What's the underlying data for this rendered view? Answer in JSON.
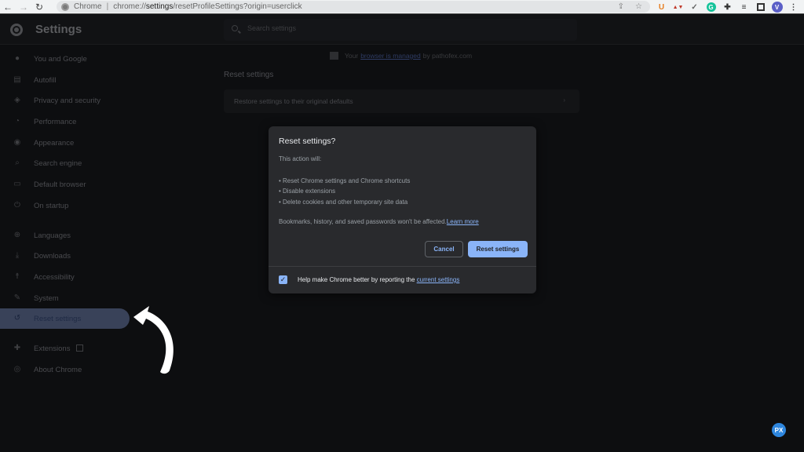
{
  "browser": {
    "site_label": "Chrome",
    "url_prefix": "chrome://",
    "url_bold": "settings",
    "url_rest": "/resetProfileSettings?origin=userclick",
    "extensions": [
      "U",
      "▲▼",
      "✓",
      "G",
      "puzzle",
      "queue",
      "panel"
    ],
    "avatar_initial": "V"
  },
  "header": {
    "title": "Settings",
    "search_placeholder": "Search settings"
  },
  "sidebar": {
    "items": [
      {
        "label": "You and Google",
        "icon": "person-icon"
      },
      {
        "label": "Autofill",
        "icon": "clipboard-icon"
      },
      {
        "label": "Privacy and security",
        "icon": "shield-icon"
      },
      {
        "label": "Performance",
        "icon": "speedometer-icon"
      },
      {
        "label": "Appearance",
        "icon": "palette-icon"
      },
      {
        "label": "Search engine",
        "icon": "search-icon"
      },
      {
        "label": "Default browser",
        "icon": "browser-icon"
      },
      {
        "label": "On startup",
        "icon": "power-icon"
      },
      {
        "label": "Languages",
        "icon": "globe-icon"
      },
      {
        "label": "Downloads",
        "icon": "download-icon"
      },
      {
        "label": "Accessibility",
        "icon": "accessibility-icon"
      },
      {
        "label": "System",
        "icon": "wrench-icon"
      },
      {
        "label": "Reset settings",
        "icon": "history-icon",
        "active": true
      },
      {
        "label": "Extensions",
        "icon": "puzzle-icon"
      },
      {
        "label": "About Chrome",
        "icon": "chrome-icon"
      }
    ]
  },
  "main": {
    "managed_prefix": "Your",
    "managed_link": "browser is managed",
    "managed_suffix": "by pathofex.com",
    "section_title": "Reset settings",
    "card_label": "Restore settings to their original defaults"
  },
  "dialog": {
    "title": "Reset settings?",
    "intro": "This action will:",
    "items": [
      "Reset Chrome settings and Chrome shortcuts",
      "Disable extensions",
      "Delete cookies and other temporary site data"
    ],
    "note": "Bookmarks, history, and saved passwords won't be affected.",
    "learn_more": "Learn more",
    "cancel_label": "Cancel",
    "reset_label": "Reset settings",
    "checkbox_checked": true,
    "checkbox_label": "Help make Chrome better by reporting the",
    "checkbox_link": "current settings"
  },
  "watermark": "PX"
}
